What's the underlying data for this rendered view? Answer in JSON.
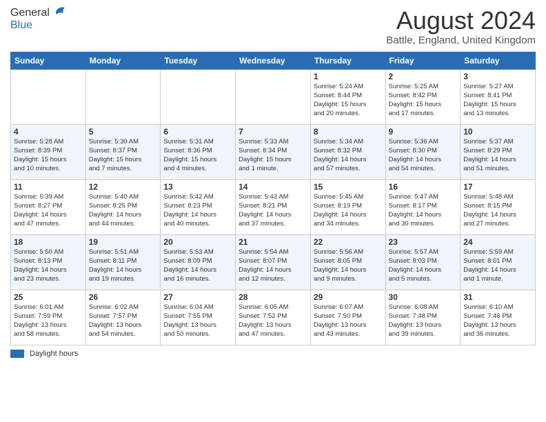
{
  "header": {
    "logo_general": "General",
    "logo_blue": "Blue",
    "main_title": "August 2024",
    "sub_title": "Battle, England, United Kingdom"
  },
  "days_of_week": [
    "Sunday",
    "Monday",
    "Tuesday",
    "Wednesday",
    "Thursday",
    "Friday",
    "Saturday"
  ],
  "weeks": [
    [
      {
        "day": "",
        "info": ""
      },
      {
        "day": "",
        "info": ""
      },
      {
        "day": "",
        "info": ""
      },
      {
        "day": "",
        "info": ""
      },
      {
        "day": "1",
        "info": "Sunrise: 5:24 AM\nSunset: 8:44 PM\nDaylight: 15 hours\nand 20 minutes."
      },
      {
        "day": "2",
        "info": "Sunrise: 5:25 AM\nSunset: 8:42 PM\nDaylight: 15 hours\nand 17 minutes."
      },
      {
        "day": "3",
        "info": "Sunrise: 5:27 AM\nSunset: 8:41 PM\nDaylight: 15 hours\nand 13 minutes."
      }
    ],
    [
      {
        "day": "4",
        "info": "Sunrise: 5:28 AM\nSunset: 8:39 PM\nDaylight: 15 hours\nand 10 minutes."
      },
      {
        "day": "5",
        "info": "Sunrise: 5:30 AM\nSunset: 8:37 PM\nDaylight: 15 hours\nand 7 minutes."
      },
      {
        "day": "6",
        "info": "Sunrise: 5:31 AM\nSunset: 8:36 PM\nDaylight: 15 hours\nand 4 minutes."
      },
      {
        "day": "7",
        "info": "Sunrise: 5:33 AM\nSunset: 8:34 PM\nDaylight: 15 hours\nand 1 minute."
      },
      {
        "day": "8",
        "info": "Sunrise: 5:34 AM\nSunset: 8:32 PM\nDaylight: 14 hours\nand 57 minutes."
      },
      {
        "day": "9",
        "info": "Sunrise: 5:36 AM\nSunset: 8:30 PM\nDaylight: 14 hours\nand 54 minutes."
      },
      {
        "day": "10",
        "info": "Sunrise: 5:37 AM\nSunset: 8:29 PM\nDaylight: 14 hours\nand 51 minutes."
      }
    ],
    [
      {
        "day": "11",
        "info": "Sunrise: 5:39 AM\nSunset: 8:27 PM\nDaylight: 14 hours\nand 47 minutes."
      },
      {
        "day": "12",
        "info": "Sunrise: 5:40 AM\nSunset: 8:25 PM\nDaylight: 14 hours\nand 44 minutes."
      },
      {
        "day": "13",
        "info": "Sunrise: 5:42 AM\nSunset: 8:23 PM\nDaylight: 14 hours\nand 40 minutes."
      },
      {
        "day": "14",
        "info": "Sunrise: 5:43 AM\nSunset: 8:21 PM\nDaylight: 14 hours\nand 37 minutes."
      },
      {
        "day": "15",
        "info": "Sunrise: 5:45 AM\nSunset: 8:19 PM\nDaylight: 14 hours\nand 34 minutes."
      },
      {
        "day": "16",
        "info": "Sunrise: 5:47 AM\nSunset: 8:17 PM\nDaylight: 14 hours\nand 30 minutes."
      },
      {
        "day": "17",
        "info": "Sunrise: 5:48 AM\nSunset: 8:15 PM\nDaylight: 14 hours\nand 27 minutes."
      }
    ],
    [
      {
        "day": "18",
        "info": "Sunrise: 5:50 AM\nSunset: 8:13 PM\nDaylight: 14 hours\nand 23 minutes."
      },
      {
        "day": "19",
        "info": "Sunrise: 5:51 AM\nSunset: 8:11 PM\nDaylight: 14 hours\nand 19 minutes."
      },
      {
        "day": "20",
        "info": "Sunrise: 5:53 AM\nSunset: 8:09 PM\nDaylight: 14 hours\nand 16 minutes."
      },
      {
        "day": "21",
        "info": "Sunrise: 5:54 AM\nSunset: 8:07 PM\nDaylight: 14 hours\nand 12 minutes."
      },
      {
        "day": "22",
        "info": "Sunrise: 5:56 AM\nSunset: 8:05 PM\nDaylight: 14 hours\nand 9 minutes."
      },
      {
        "day": "23",
        "info": "Sunrise: 5:57 AM\nSunset: 8:03 PM\nDaylight: 14 hours\nand 5 minutes."
      },
      {
        "day": "24",
        "info": "Sunrise: 5:59 AM\nSunset: 8:01 PM\nDaylight: 14 hours\nand 1 minute."
      }
    ],
    [
      {
        "day": "25",
        "info": "Sunrise: 6:01 AM\nSunset: 7:59 PM\nDaylight: 13 hours\nand 58 minutes."
      },
      {
        "day": "26",
        "info": "Sunrise: 6:02 AM\nSunset: 7:57 PM\nDaylight: 13 hours\nand 54 minutes."
      },
      {
        "day": "27",
        "info": "Sunrise: 6:04 AM\nSunset: 7:55 PM\nDaylight: 13 hours\nand 50 minutes."
      },
      {
        "day": "28",
        "info": "Sunrise: 6:05 AM\nSunset: 7:52 PM\nDaylight: 13 hours\nand 47 minutes."
      },
      {
        "day": "29",
        "info": "Sunrise: 6:07 AM\nSunset: 7:50 PM\nDaylight: 13 hours\nand 43 minutes."
      },
      {
        "day": "30",
        "info": "Sunrise: 6:08 AM\nSunset: 7:48 PM\nDaylight: 13 hours\nand 39 minutes."
      },
      {
        "day": "31",
        "info": "Sunrise: 6:10 AM\nSunset: 7:46 PM\nDaylight: 13 hours\nand 36 minutes."
      }
    ]
  ],
  "footer": {
    "legend_label": "Daylight hours"
  }
}
